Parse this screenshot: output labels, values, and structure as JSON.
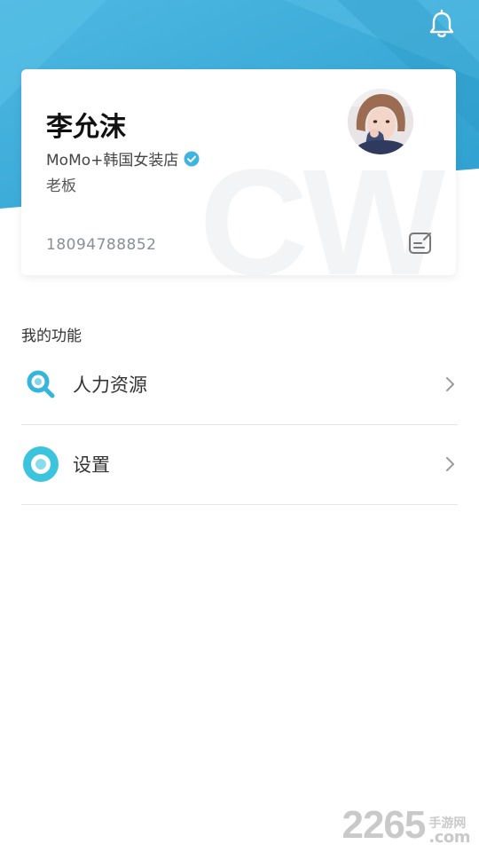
{
  "colors": {
    "header_primary": "#36A9D6",
    "header_light": "#55BEE4",
    "accent_icon": "#33B7DB",
    "text_dark": "#111111",
    "text_secondary": "#8a8f96"
  },
  "header": {
    "bell_icon": "bell-icon"
  },
  "profile": {
    "name": "李允沫",
    "store": "MoMo+韩国女装店",
    "role": "老板",
    "phone": "18094788852",
    "watermark": "CW",
    "verified_icon": "verified-check-icon",
    "edit_icon": "edit-note-icon",
    "avatar_icon": "avatar"
  },
  "functions": {
    "title": "我的功能",
    "items": [
      {
        "label": "人力资源",
        "icon": "search-icon"
      },
      {
        "label": "设置",
        "icon": "settings-icon"
      }
    ]
  },
  "branding": {
    "big": "2265",
    "small": "手游网",
    "dotcom": ".com"
  }
}
